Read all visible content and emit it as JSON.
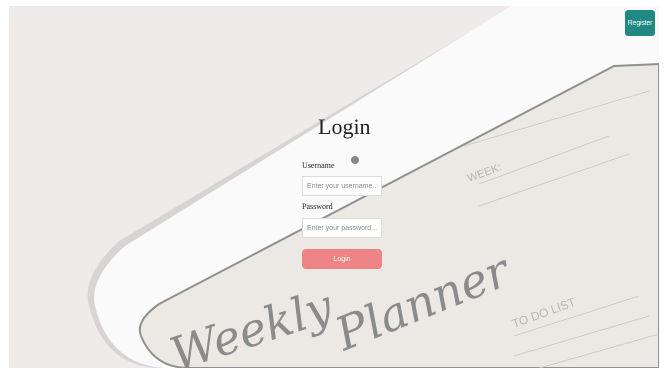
{
  "header": {
    "register_label": "Register"
  },
  "login": {
    "title": "Login",
    "username_label": "Username",
    "username_placeholder": "Enter your username...",
    "password_label": "Password",
    "password_placeholder": "Enter your password...",
    "submit_label": "Login"
  },
  "background": {
    "tablet_week_label": "WEEK:",
    "tablet_todo_label": "TO DO LIST",
    "tablet_script_weekly": "Weekly",
    "tablet_script_planner": "Planner"
  },
  "colors": {
    "accent_teal": "#1e8a83",
    "login_button": "#ed8385",
    "background": "#efebeb"
  }
}
